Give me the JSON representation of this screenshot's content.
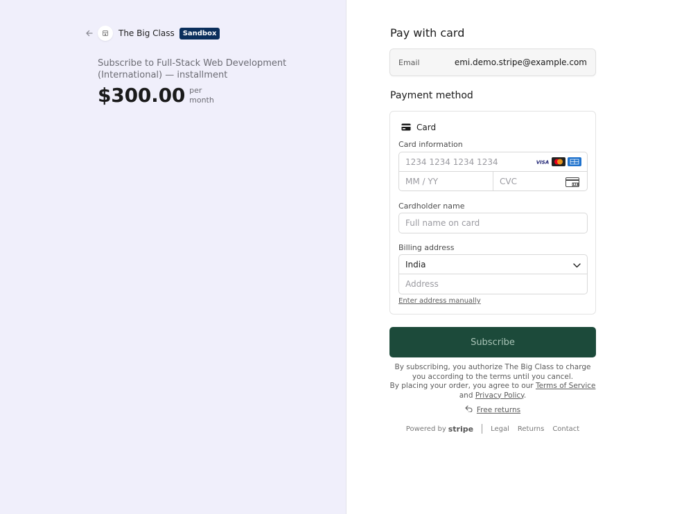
{
  "merchant": {
    "name": "The Big Class",
    "badge": "Sandbox"
  },
  "product": {
    "name": "Subscribe to Full-Stack Web Development (International) — installment",
    "amount": "$300.00",
    "interval_line1": "per",
    "interval_line2": "month"
  },
  "checkout": {
    "title": "Pay with card",
    "email_label": "Email",
    "email_value": "emi.demo.stripe@example.com",
    "payment_method_title": "Payment method",
    "card_tab_label": "Card",
    "card_info_label": "Card information",
    "card_number_placeholder": "1234 1234 1234 1234",
    "expiry_placeholder": "MM / YY",
    "cvc_placeholder": "CVC",
    "cardholder_label": "Cardholder name",
    "cardholder_placeholder": "Full name on card",
    "billing_label": "Billing address",
    "country_value": "India",
    "address_placeholder": "Address",
    "enter_manually": "Enter address manually",
    "subscribe_label": "Subscribe"
  },
  "terms": {
    "line1": "By subscribing, you authorize The Big Class to charge you according to the terms until you cancel.",
    "line2_prefix": "By placing your order, you agree to our",
    "tos": "Terms of Service",
    "and": "and",
    "privacy": "Privacy Policy",
    "period": "."
  },
  "returns": {
    "label": "Free returns"
  },
  "footer": {
    "powered_by": "Powered by",
    "brand": "stripe",
    "legal": "Legal",
    "returns": "Returns",
    "contact": "Contact"
  },
  "icons": {
    "back": "arrow-left-icon",
    "merchant_logo": "store-icon",
    "card": "credit-card-icon",
    "visa": "visa-icon",
    "mastercard": "mastercard-icon",
    "amex": "amex-icon",
    "cvc": "cvc-card-icon",
    "chevron": "chevron-down-icon",
    "returns": "return-arrow-icon"
  },
  "colors": {
    "left_bg": "#f0effb",
    "sandbox_badge": "#0b2f5c",
    "subscribe_button": "#1c4a3a"
  }
}
